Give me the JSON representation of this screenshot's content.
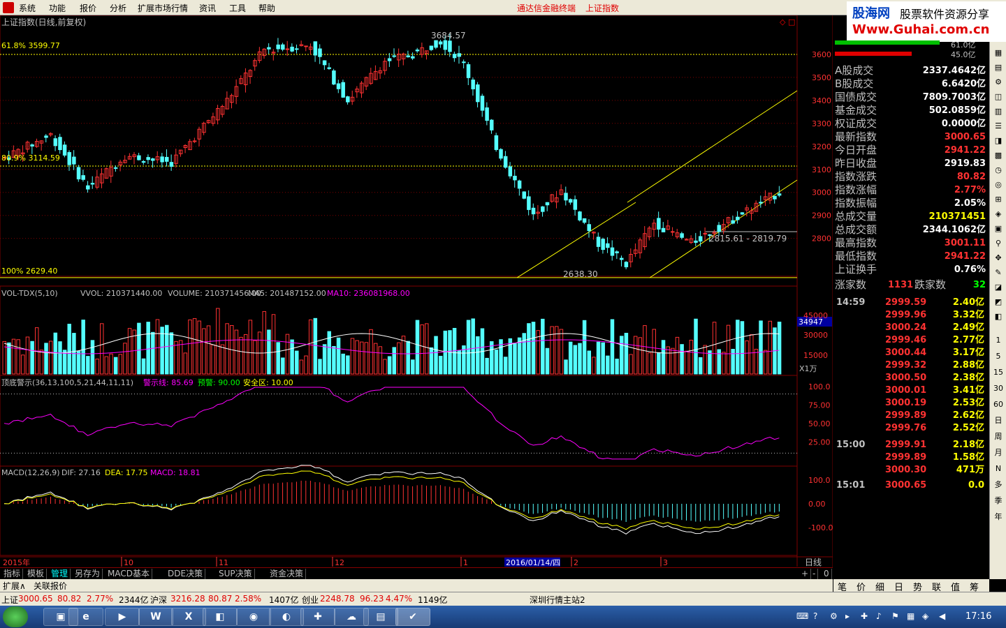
{
  "menu": [
    "系统",
    "功能",
    "报价",
    "分析",
    "扩展市场行情",
    "资讯",
    "工具",
    "帮助"
  ],
  "app_title": "通达信金融终端",
  "security_title": "上证指数",
  "brand": {
    "a": "股海网",
    "b": "股票软件资源分享",
    "c": "Www.Guhai.com.cn"
  },
  "main": {
    "title": "上证指数(日线,前复权)",
    "fib_61": "61.8% 3599.77",
    "fib_809": "80.9% 3114.59",
    "fib_100": "100% 2629.40",
    "high_label": "3684.57",
    "low_label": "2638.30",
    "range_label": "2815.61 - 2819.79",
    "y_ticks": [
      "3600",
      "3500",
      "3400",
      "3300",
      "3200",
      "3100",
      "3000",
      "2900",
      "2800"
    ],
    "corner": "◇ □"
  },
  "vol": {
    "label": "VOL-TDX(5,10)",
    "vvol": "VVOL: 210371440.00",
    "volume": "VOLUME: 210371456.00",
    "ma5": "MA5: 201487152.00",
    "ma10": "MA10: 236081968.00",
    "y_ticks": [
      "45000",
      "30000",
      "15000"
    ],
    "cur_tag": "34947",
    "unit": "X1万"
  },
  "ind": {
    "label": "顶底警示(36,13,100,5,21,44,11,11)",
    "warn": "警示线: 85.69",
    "pre": "预警: 90.00",
    "safe": "安全区: 10.00",
    "y_ticks": [
      "100.0",
      "75.00",
      "50.00",
      "25.00"
    ]
  },
  "macd": {
    "label": "MACD(12,26,9)",
    "dif": "DIF: 27.16",
    "dea": "DEA: 17.75",
    "macd": "MACD: 18.81",
    "y_ticks": [
      "100.0",
      "0.00",
      "-100.0"
    ]
  },
  "xaxis": {
    "year": "2015年",
    "months": [
      "10",
      "11",
      "12",
      "1",
      "2",
      "3"
    ],
    "cursor": "2016/01/14/四",
    "period": "日线"
  },
  "info_top": {
    "v1": "61.0亿",
    "v2": "45.0亿"
  },
  "info": [
    {
      "l": "A股成交",
      "v": "2337.4642亿",
      "c": "#ffffff"
    },
    {
      "l": "B股成交",
      "v": "6.6420亿",
      "c": "#ffffff"
    },
    {
      "l": "国债成交",
      "v": "7809.7003亿",
      "c": "#ffffff"
    },
    {
      "l": "基金成交",
      "v": "502.0859亿",
      "c": "#ffffff"
    },
    {
      "l": "权证成交",
      "v": "0.0000亿",
      "c": "#ffffff"
    },
    {
      "l": "最新指数",
      "v": "3000.65",
      "c": "#ff3232"
    },
    {
      "l": "今日开盘",
      "v": "2941.22",
      "c": "#ff3232"
    },
    {
      "l": "昨日收盘",
      "v": "2919.83",
      "c": "#ffffff"
    },
    {
      "l": "指数涨跌",
      "v": "80.82",
      "c": "#ff3232"
    },
    {
      "l": "指数涨幅",
      "v": "2.77%",
      "c": "#ff3232"
    },
    {
      "l": "指数振幅",
      "v": "2.05%",
      "c": "#ffffff"
    },
    {
      "l": "总成交量",
      "v": "210371451",
      "c": "#ffff00"
    },
    {
      "l": "总成交额",
      "v": "2344.1062亿",
      "c": "#ffffff"
    },
    {
      "l": "最高指数",
      "v": "3001.11",
      "c": "#ff3232"
    },
    {
      "l": "最低指数",
      "v": "2941.22",
      "c": "#ff3232"
    },
    {
      "l": "上证换手",
      "v": "0.76%",
      "c": "#ffffff"
    }
  ],
  "breadth": {
    "up_label": "涨家数",
    "up": "1131",
    "down_label": "跌家数",
    "down": "32"
  },
  "ticks": [
    {
      "t": "14:59",
      "p": "2999.59",
      "v": "2.40亿"
    },
    {
      "t": "",
      "p": "2999.96",
      "v": "3.32亿"
    },
    {
      "t": "",
      "p": "3000.24",
      "v": "2.49亿"
    },
    {
      "t": "",
      "p": "2999.46",
      "v": "2.77亿"
    },
    {
      "t": "",
      "p": "3000.44",
      "v": "3.17亿"
    },
    {
      "t": "",
      "p": "2999.32",
      "v": "2.88亿"
    },
    {
      "t": "",
      "p": "3000.50",
      "v": "2.38亿"
    },
    {
      "t": "",
      "p": "3000.01",
      "v": "3.41亿"
    },
    {
      "t": "",
      "p": "3000.19",
      "v": "2.53亿"
    },
    {
      "t": "",
      "p": "2999.89",
      "v": "2.62亿"
    },
    {
      "t": "",
      "p": "2999.76",
      "v": "2.52亿"
    },
    {
      "t": "15:00",
      "p": "2999.91",
      "v": "2.18亿"
    },
    {
      "t": "",
      "p": "2999.89",
      "v": "1.58亿"
    },
    {
      "t": "",
      "p": "3000.30",
      "v": "471万"
    },
    {
      "t": "15:01",
      "p": "3000.65",
      "v": "0.0"
    }
  ],
  "bottom_tabs": [
    "指标",
    "模板",
    "管理",
    "另存为",
    "MACD基本",
    "DDE决策",
    "SUP决策",
    "资金决策"
  ],
  "bottom_ctrl": [
    "+",
    "-",
    "0"
  ],
  "ext_tabs": [
    "扩展∧",
    "关联报价"
  ],
  "right_tabs": [
    "笔",
    "价",
    "细",
    "日",
    "势",
    "联",
    "值",
    "筹"
  ],
  "right_icons": [
    "1",
    "5",
    "15",
    "30",
    "60",
    "日",
    "周",
    "月",
    "N",
    "多",
    "季",
    "年"
  ],
  "status": [
    {
      "t": "上证",
      "c": "#000"
    },
    {
      "t": "3000.65",
      "c": "#e00000"
    },
    {
      "t": "80.82",
      "c": "#e00000"
    },
    {
      "t": "2.77%",
      "c": "#e00000"
    },
    {
      "t": "2344亿",
      "c": "#000"
    },
    {
      "t": "沪深",
      "c": "#000"
    },
    {
      "t": "3216.28",
      "c": "#e00000"
    },
    {
      "t": "80.87",
      "c": "#e00000"
    },
    {
      "t": "2.58%",
      "c": "#e00000"
    },
    {
      "t": "1407亿",
      "c": "#000"
    },
    {
      "t": "创业",
      "c": "#000"
    },
    {
      "t": "2248.78",
      "c": "#e00000"
    },
    {
      "t": "96.23",
      "c": "#e00000"
    },
    {
      "t": "4.47%",
      "c": "#e00000"
    },
    {
      "t": "1149亿",
      "c": "#000"
    },
    {
      "t": "深圳行情主站2",
      "c": "#000"
    }
  ],
  "clock": "17:16",
  "colors": {
    "up": "#ff3232",
    "down": "#54ffff",
    "yellow": "#ffff00",
    "magenta": "#ff00ff",
    "grid": "#800000"
  }
}
